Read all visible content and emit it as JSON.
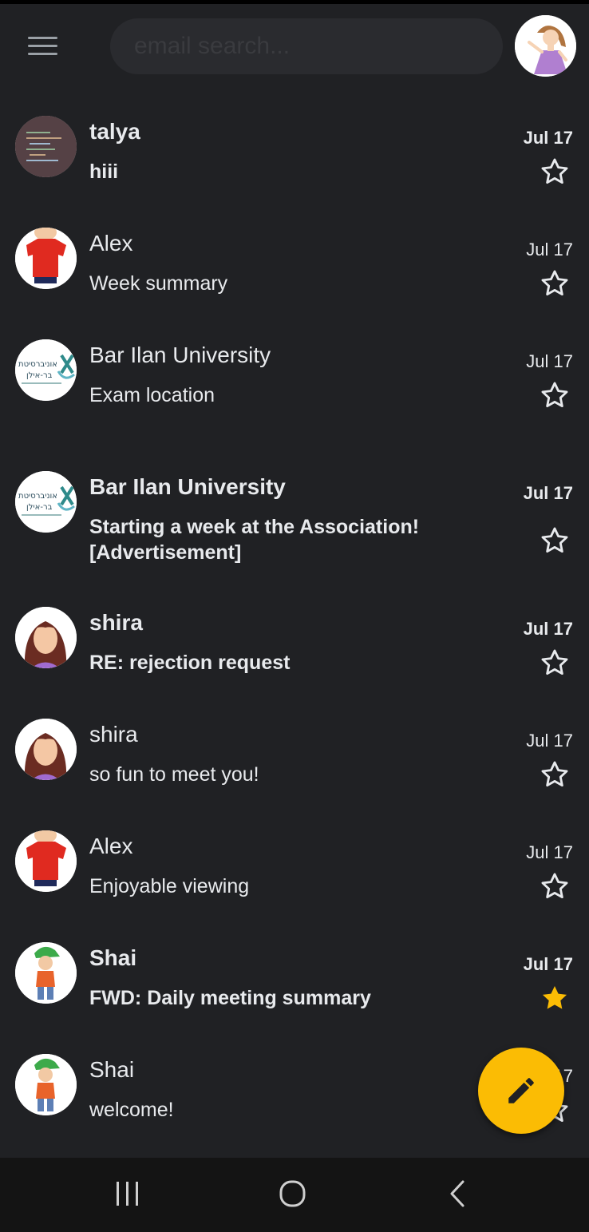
{
  "search": {
    "placeholder": "email search..."
  },
  "colors": {
    "background": "#202124",
    "accent": "#fbbc04",
    "star_outline": "#e8eaed"
  },
  "emails": [
    {
      "sender": "talya",
      "subject": "hiii",
      "date": "Jul 17",
      "unread": true,
      "starred": false,
      "avatar": "code-photo-avatar"
    },
    {
      "sender": "Alex",
      "subject": "Week summary",
      "date": "Jul 17",
      "unread": false,
      "starred": false,
      "avatar": "boy-red-shirt-avatar"
    },
    {
      "sender": "Bar Ilan University",
      "subject": "Exam location",
      "date": "Jul 17",
      "unread": false,
      "starred": false,
      "avatar": "university-logo-avatar"
    },
    {
      "sender": "Bar Ilan University",
      "subject": "Starting a week at the Association! [Advertisement]",
      "date": "Jul 17",
      "unread": true,
      "starred": false,
      "avatar": "university-logo-avatar"
    },
    {
      "sender": "shira",
      "subject": "RE: rejection request",
      "date": "Jul 17",
      "unread": true,
      "starred": false,
      "avatar": "girl-avatar"
    },
    {
      "sender": "shira",
      "subject": "so fun to meet you!",
      "date": "Jul 17",
      "unread": false,
      "starred": false,
      "avatar": "girl-avatar"
    },
    {
      "sender": "Alex",
      "subject": "Enjoyable viewing",
      "date": "Jul 17",
      "unread": false,
      "starred": false,
      "avatar": "boy-red-shirt-avatar"
    },
    {
      "sender": "Shai",
      "subject": "FWD: Daily meeting summary",
      "date": "Jul 17",
      "unread": true,
      "starred": true,
      "avatar": "boy-green-cap-avatar"
    },
    {
      "sender": "Shai",
      "subject": "welcome!",
      "date": "Jul 17",
      "unread": false,
      "starred": false,
      "avatar": "boy-green-cap-avatar"
    }
  ],
  "logo": {
    "line1": "אוניברסיטת",
    "line2": "בר-אילן"
  },
  "icons": {
    "menu": "hamburger-menu-icon",
    "compose": "pencil-icon",
    "star": "star-icon"
  }
}
